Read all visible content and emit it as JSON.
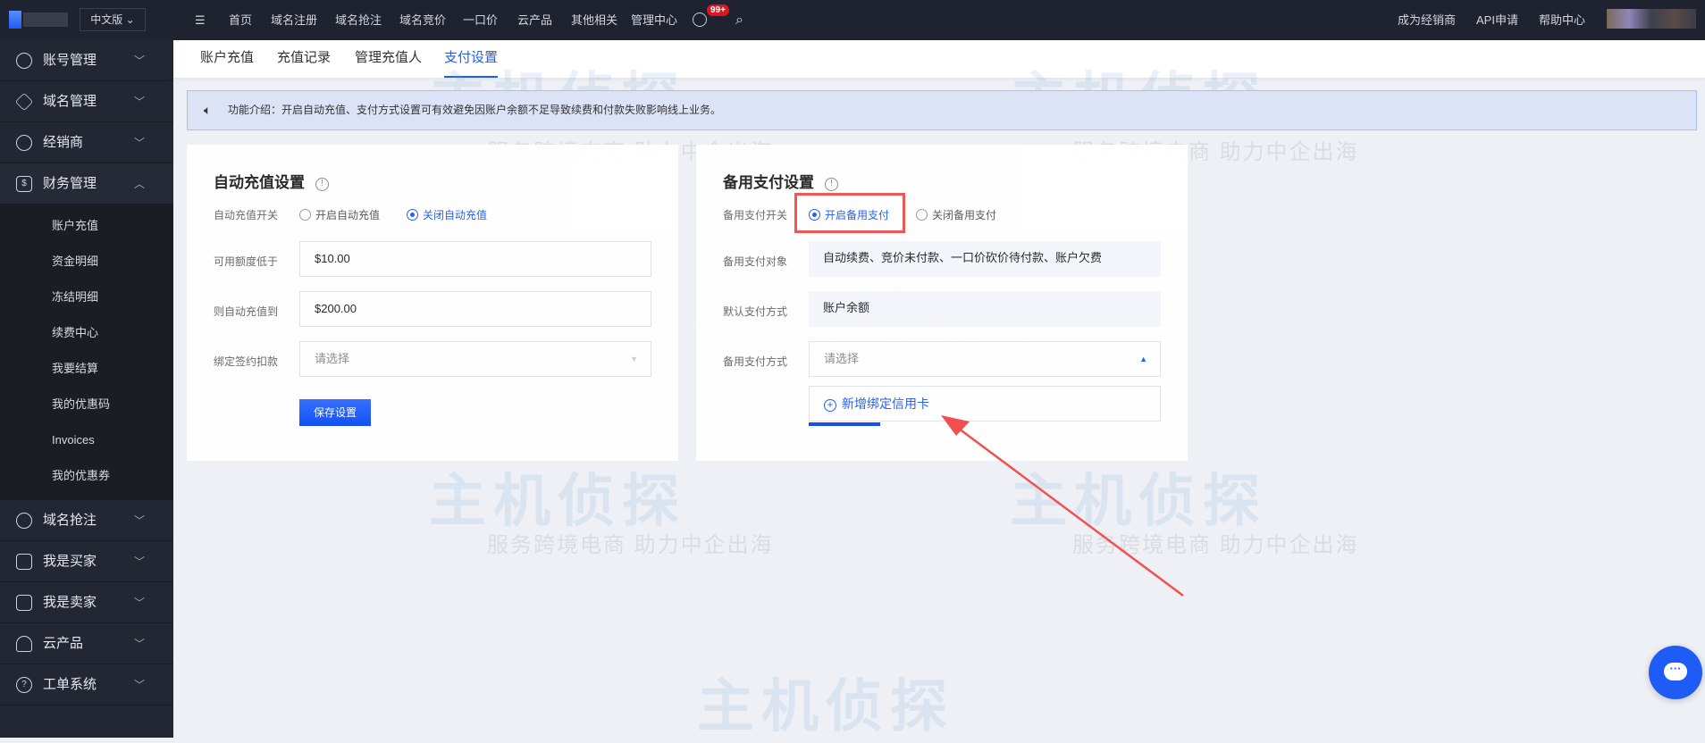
{
  "topbar": {
    "lang": "中文版",
    "nav": [
      "首页",
      "域名注册",
      "域名抢注",
      "域名竞价",
      "一口价",
      "云产品",
      "其他相关",
      "管理中心"
    ],
    "cart_badge": "99+",
    "right": [
      "成为经销商",
      "API申请",
      "帮助中心"
    ]
  },
  "sidebar": {
    "items": [
      {
        "label": "账号管理",
        "icon": "user-icon"
      },
      {
        "label": "域名管理",
        "icon": "layers-icon"
      },
      {
        "label": "经销商",
        "icon": "users-icon"
      },
      {
        "label": "财务管理",
        "icon": "dollar-icon"
      }
    ],
    "sub": [
      "账户充值",
      "资金明细",
      "冻结明细",
      "续费中心",
      "我要结算",
      "我的优惠码",
      "Invoices",
      "我的优惠券"
    ],
    "items2": [
      {
        "label": "域名抢注",
        "icon": "clock-icon"
      },
      {
        "label": "我是买家",
        "icon": "cart-icon"
      },
      {
        "label": "我是卖家",
        "icon": "shop-icon"
      },
      {
        "label": "云产品",
        "icon": "cloud-icon"
      },
      {
        "label": "工单系统",
        "icon": "question-icon"
      }
    ]
  },
  "tabs": [
    "账户充值",
    "充值记录",
    "管理充值人",
    "支付设置"
  ],
  "notice": "功能介绍：开启自动充值、支付方式设置可有效避免因账户余额不足导致续费和付款失败影响线上业务。",
  "auto": {
    "title": "自动充值设置",
    "switch_label": "自动充值开关",
    "opt_on": "开启自动充值",
    "opt_off": "关闭自动充值",
    "low_label": "可用额度低于",
    "low_value": "$10.00",
    "to_label": "则自动充值到",
    "to_value": "$200.00",
    "bind_label": "绑定签约扣款",
    "bind_placeholder": "请选择",
    "save": "保存设置"
  },
  "backup": {
    "title": "备用支付设置",
    "switch_label": "备用支付开关",
    "opt_on": "开启备用支付",
    "opt_off": "关闭备用支付",
    "target_label": "备用支付对象",
    "target_value": "自动续费、竞价未付款、一口价砍价待付款、账户欠费",
    "default_label": "默认支付方式",
    "default_value": "账户余额",
    "method_label": "备用支付方式",
    "method_placeholder": "请选择",
    "add_card": "新增绑定信用卡"
  },
  "watermark": {
    "brand": "主机侦探",
    "slogan": "服务跨境电商 助力中企出海"
  },
  "colors": {
    "accent": "#1e5cf5",
    "highlight": "#f05050"
  }
}
